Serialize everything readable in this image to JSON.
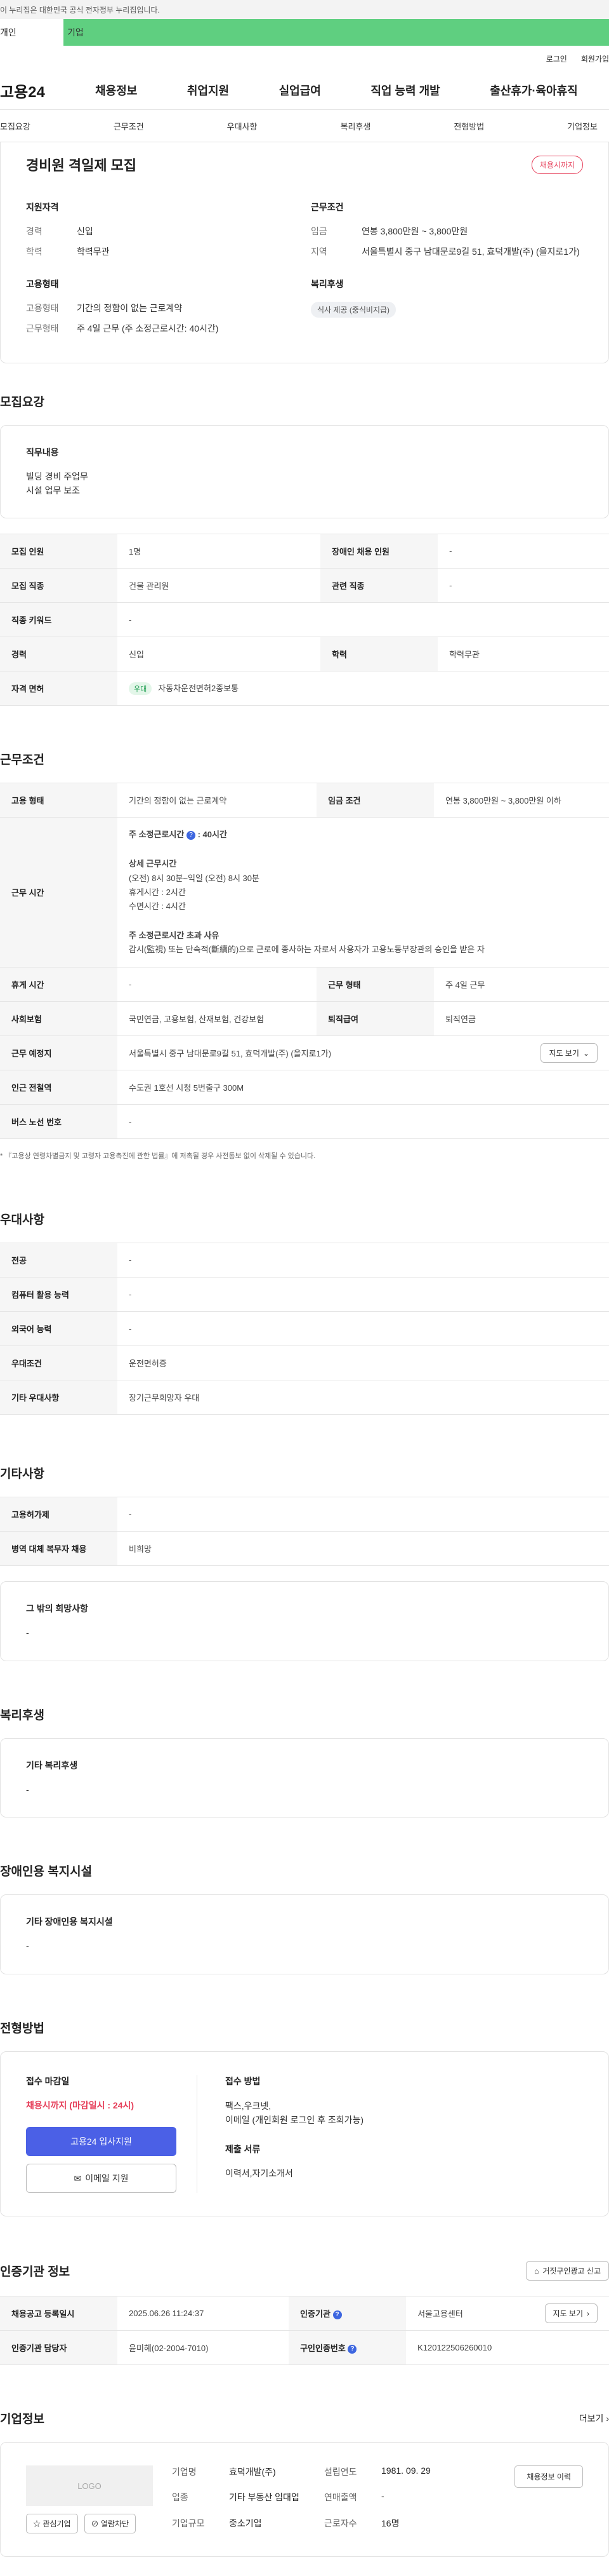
{
  "gov_banner": "이 누리집은 대한민국 공식 전자정부 누리집입니다.",
  "type_tabs": [
    "개인",
    "기업"
  ],
  "util": [
    "로그인",
    "회원가입"
  ],
  "logo": "고용24",
  "nav": [
    "채용정보",
    "취업지원",
    "실업급여",
    "직업 능력 개발",
    "출산휴가·육아휴직"
  ],
  "sub_tabs": [
    "모집요강",
    "근무조건",
    "우대사항",
    "복리후생",
    "전형방법",
    "기업정보"
  ],
  "summary": {
    "title": "경비원 격일제 모집",
    "badge": "채용시까지",
    "qual": {
      "title": "지원자격",
      "rows": [
        {
          "k": "경력",
          "v": "신입"
        },
        {
          "k": "학력",
          "v": "학력무관"
        }
      ]
    },
    "cond": {
      "title": "근무조건",
      "rows": [
        {
          "k": "임금",
          "v": "연봉 3,800만원 ~ 3,800만원"
        },
        {
          "k": "지역",
          "v": "서울특별시 중구 남대문로9길 51, 효덕개발(주) (을지로1가)"
        }
      ]
    },
    "emp": {
      "title": "고용형태",
      "rows": [
        {
          "k": "고용형태",
          "v": "기간의 정함이 없는 근로계약"
        },
        {
          "k": "근무형태",
          "v": "주 4일 근무 (주 소정근로시간: 40시간)"
        }
      ]
    },
    "welfare": {
      "title": "복리후생",
      "chip": "식사 제공 (중식비지급)"
    }
  },
  "recruit": {
    "title": "모집요강",
    "duty_title": "직무내용",
    "duty_lines": [
      "빌딩 경비 주업무",
      "시설 업무 보조"
    ],
    "rows": [
      [
        {
          "k": "모집 인원",
          "v": "1명"
        },
        {
          "k": "장애인 채용 인원",
          "v": "-"
        }
      ],
      [
        {
          "k": "모집 직종",
          "v": "건물 관리원"
        },
        {
          "k": "관련 직종",
          "v": "-"
        }
      ],
      [
        {
          "k": "직종 키워드",
          "v": "-"
        }
      ],
      [
        {
          "k": "경력",
          "v": "신입"
        },
        {
          "k": "학력",
          "v": "학력무관"
        }
      ]
    ],
    "license": {
      "k": "자격 면허",
      "tag": "우대",
      "v": "자동차운전면허2종보통"
    }
  },
  "work": {
    "title": "근무조건",
    "row1": [
      {
        "k": "고용 형태",
        "v": "기간의 정함이 없는 근로계약"
      },
      {
        "k": "임금 조건",
        "v": "연봉 3,800만원 ~ 3,800만원 이하"
      }
    ],
    "hours_k": "근무 시간",
    "hours_title": "주 소정근로시간",
    "hours_value": ": 40시간",
    "detail_title": "상세 근무시간",
    "detail_lines": [
      "(오전) 8시 30분~익일 (오전) 8시 30분",
      "휴게시간 : 2시간",
      "수면시간 : 4시간"
    ],
    "over_title": "주 소정근로시간 초과 사유",
    "over_text": "감시(監視) 또는 단속적(斷續的)으로 근로에 종사하는 자로서 사용자가 고용노동부장관의 승인을 받은 자",
    "row_rest": [
      {
        "k": "휴게 시간",
        "v": "-"
      },
      {
        "k": "근무 형태",
        "v": "주 4일 근무"
      }
    ],
    "row_ins": [
      {
        "k": "사회보험",
        "v": "국민연금, 고용보험, 산재보험, 건강보험"
      },
      {
        "k": "퇴직급여",
        "v": "퇴직연금"
      }
    ],
    "place": {
      "k": "근무 예정지",
      "v": "서울특별시 중구 남대문로9길 51, 효덕개발(주) (을지로1가)",
      "btn": "지도 보기"
    },
    "station": {
      "k": "인근 전철역",
      "v": "수도권 1호선 시청 5번출구 300M"
    },
    "bus": {
      "k": "버스 노선 번호",
      "v": "-"
    },
    "note": "* 『고용상 연령차별금지 및 고령자 고용촉진에 관한 법률』에 저촉될 경우 사전통보 없이 삭제될 수 있습니다."
  },
  "pref": {
    "title": "우대사항",
    "rows": [
      {
        "k": "전공",
        "v": "-"
      },
      {
        "k": "컴퓨터 활용 능력",
        "v": "-"
      },
      {
        "k": "외국어 능력",
        "v": "-"
      },
      {
        "k": "우대조건",
        "v": "운전면허증"
      },
      {
        "k": "기타 우대사항",
        "v": "장기근무희망자 우대"
      }
    ]
  },
  "etc": {
    "title": "기타사항",
    "rows": [
      {
        "k": "고용허가제",
        "v": "-"
      },
      {
        "k": "병역 대체 복무자 채용",
        "v": "비희망"
      }
    ],
    "box_title": "그 밖의 희망사항",
    "box_text": "-"
  },
  "benefit": {
    "title": "복리후생",
    "box_title": "기타 복리후생",
    "box_text": "-"
  },
  "disabled": {
    "title": "장애인용 복지시설",
    "box_title": "기타 장애인용 복지시설",
    "box_text": "-"
  },
  "process": {
    "title": "전형방법",
    "deadline_title": "접수 마감일",
    "deadline": "채용시까지 (마감일시 : 24시)",
    "apply_btn": "고용24 입사지원",
    "email_btn": "이메일 지원",
    "method_title": "접수 방법",
    "method_lines": [
      "팩스,우크넷,",
      "이메일 (개인회원 로그인 후 조회가능)"
    ],
    "docs_title": "제출 서류",
    "docs": "이력서,자기소개서"
  },
  "cert": {
    "title": "인증기관 정보",
    "report_btn": "거짓구인광고 신고",
    "row1": [
      {
        "k": "채용공고 등록일시",
        "v": "2025.06.26 11:24:37"
      },
      {
        "k": "인증기관",
        "v": "서울고용센터",
        "btn": "지도 보기"
      }
    ],
    "row2": [
      {
        "k": "인증기관 담당자",
        "v": "윤미혜(02-2004-7010)"
      },
      {
        "k": "구인인증번호",
        "v": "K120122506260010"
      }
    ]
  },
  "company": {
    "title": "기업정보",
    "more": "더보기",
    "logo_text": "LOGO",
    "fav_btn": "관심기업",
    "block_btn": "열람차단",
    "fields": [
      {
        "k": "기업명",
        "v": "효덕개발(주)"
      },
      {
        "k": "설립연도",
        "v": "1981. 09. 29"
      },
      {
        "k": "업종",
        "v": "기타 부동산 임대업"
      },
      {
        "k": "연매출액",
        "v": "-"
      },
      {
        "k": "기업규모",
        "v": "중소기업"
      },
      {
        "k": "근로자수",
        "v": "16명"
      }
    ],
    "history_btn": "채용정보 이력"
  }
}
